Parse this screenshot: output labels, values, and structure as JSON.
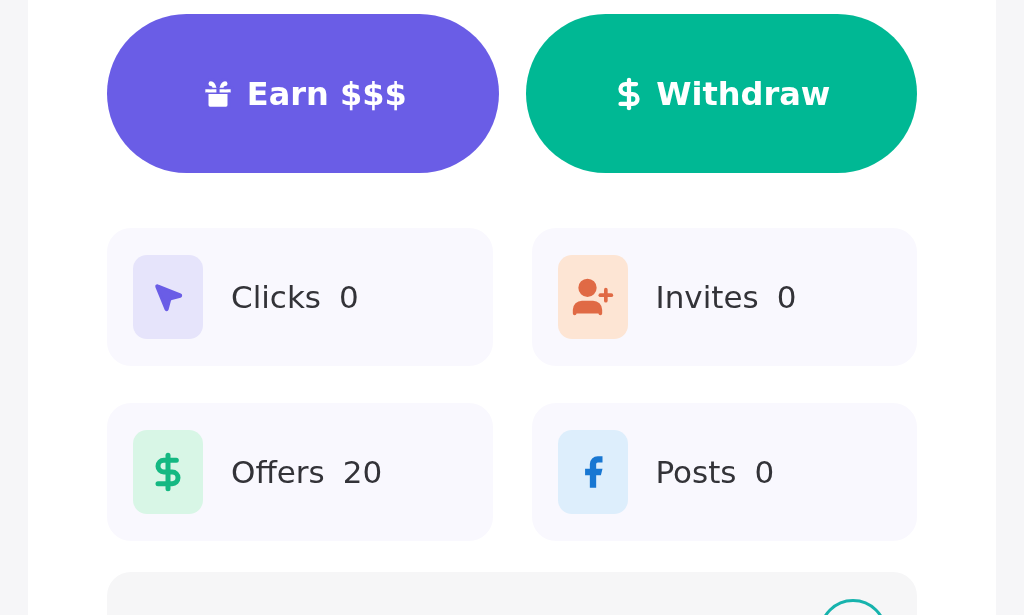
{
  "actions": [
    {
      "kind": "earn",
      "label": "Earn $$$"
    },
    {
      "kind": "withdraw",
      "label": "Withdraw"
    }
  ],
  "stats": [
    {
      "kind": "clicks",
      "label": "Clicks",
      "value": "0"
    },
    {
      "kind": "invites",
      "label": "Invites",
      "value": "0"
    },
    {
      "kind": "offers",
      "label": "Offers",
      "value": "20"
    },
    {
      "kind": "posts",
      "label": "Posts",
      "value": "0"
    }
  ]
}
